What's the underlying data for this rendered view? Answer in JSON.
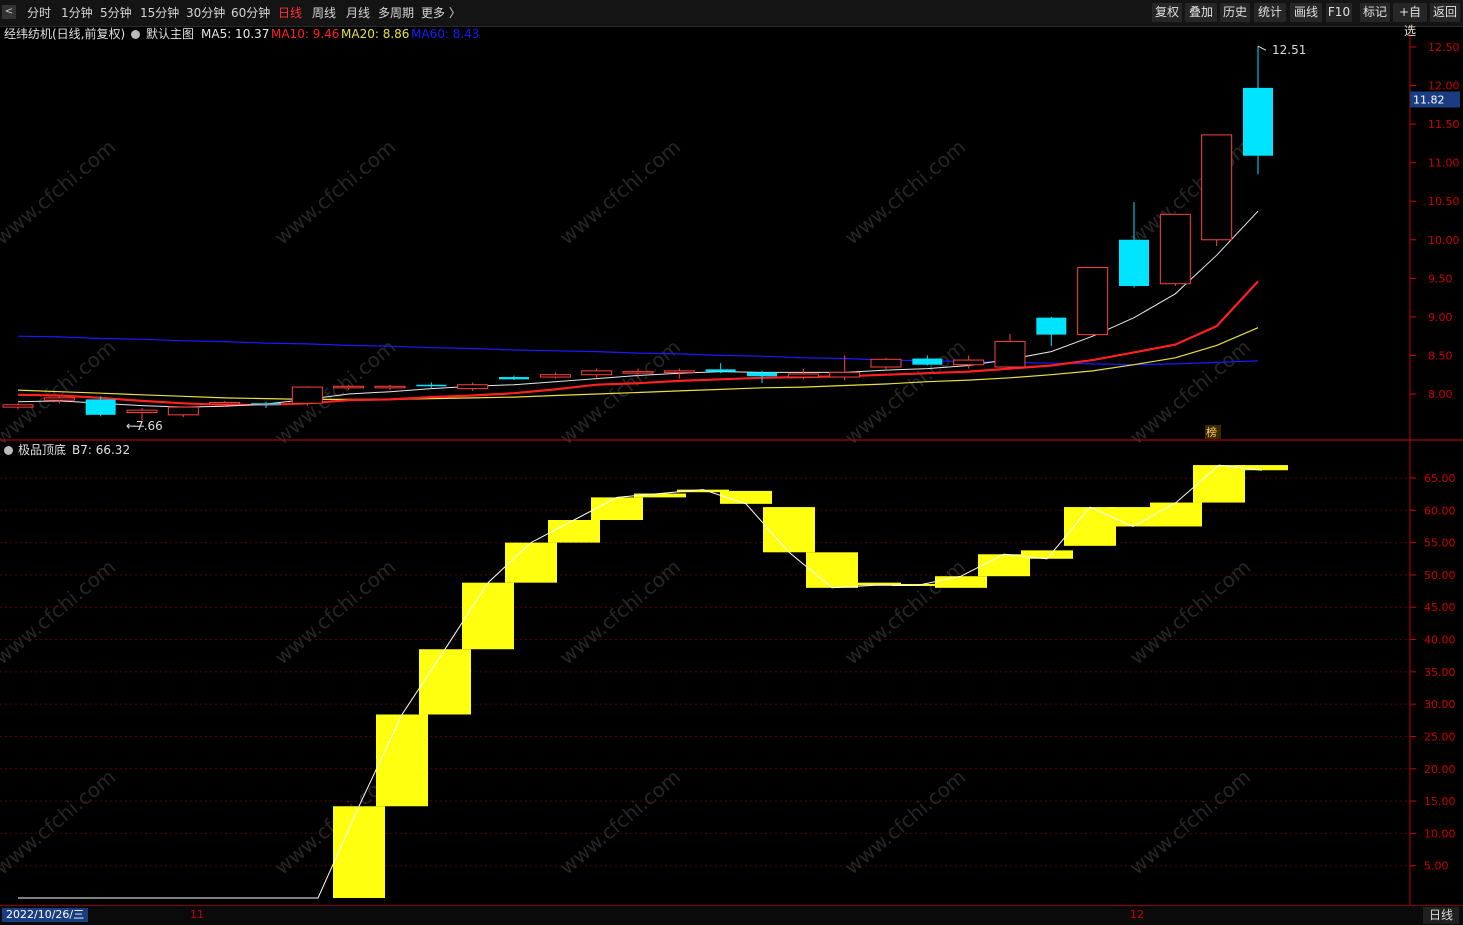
{
  "toolbar": {
    "periods": [
      "分时",
      "1分钟",
      "5分钟",
      "15分钟",
      "30分钟",
      "60分钟",
      "日线",
      "周线",
      "月线",
      "多周期",
      "更多 〉"
    ],
    "active_period": "日线",
    "right_buttons": [
      "复权",
      "叠加",
      "历史",
      "统计",
      "画线",
      "F10",
      "标记",
      "+自选",
      "返回"
    ]
  },
  "info": {
    "stock": "经纬纺机(日线,前复权)",
    "template": "默认主图",
    "ma5_label": "MA5: 10.37",
    "ma10_label": "MA10: 9.46",
    "ma20_label": "MA20: 8.86",
    "ma60_label": "MA60: 8.43"
  },
  "indicator": {
    "name": "极品顶底",
    "value_label": "B7: 66.32"
  },
  "colors": {
    "ma5": "#e8e8e8",
    "ma10": "#ff2020",
    "ma20": "#e8e040",
    "ma60": "#1a1aff",
    "up": "#ff4040",
    "down": "#00e5ff",
    "bar": "#ffff10",
    "axis": "#cc0000"
  },
  "price_axis": {
    "ticks": [
      "12.50",
      "12.00",
      "11.50",
      "11.00",
      "10.50",
      "10.00",
      "9.50",
      "9.00",
      "8.50",
      "8.00"
    ],
    "current": "11.82"
  },
  "ind_axis": {
    "ticks": [
      "65.00",
      "60.00",
      "55.00",
      "50.00",
      "45.00",
      "40.00",
      "35.00",
      "30.00",
      "25.00",
      "20.00",
      "15.00",
      "10.00",
      "5.00"
    ]
  },
  "annotations": {
    "high": "12.51",
    "low": "7.66",
    "bang": "榜"
  },
  "bottom": {
    "date": "2022/10/26/三",
    "months": [
      "11",
      "12"
    ],
    "period_button": "日线"
  },
  "watermark": "www.cfchi.com",
  "chart_data": {
    "type": "candlestick",
    "ylim_price": [
      7.6,
      12.6
    ],
    "ylim_indicator": [
      0,
      70
    ],
    "candles": [
      {
        "o": 7.83,
        "h": 7.88,
        "l": 7.8,
        "c": 7.86
      },
      {
        "o": 7.92,
        "h": 7.98,
        "l": 7.88,
        "c": 7.95
      },
      {
        "o": 7.93,
        "h": 7.97,
        "l": 7.71,
        "c": 7.73
      },
      {
        "o": 7.76,
        "h": 7.82,
        "l": 7.66,
        "c": 7.79
      },
      {
        "o": 7.73,
        "h": 7.84,
        "l": 7.7,
        "c": 7.83
      },
      {
        "o": 7.87,
        "h": 7.91,
        "l": 7.84,
        "c": 7.89
      },
      {
        "o": 7.88,
        "h": 7.9,
        "l": 7.82,
        "c": 7.87
      },
      {
        "o": 7.88,
        "h": 8.1,
        "l": 7.85,
        "c": 8.09
      },
      {
        "o": 8.08,
        "h": 8.12,
        "l": 8.05,
        "c": 8.1
      },
      {
        "o": 8.08,
        "h": 8.12,
        "l": 8.05,
        "c": 8.1
      },
      {
        "o": 8.12,
        "h": 8.15,
        "l": 8.08,
        "c": 8.1
      },
      {
        "o": 8.07,
        "h": 8.15,
        "l": 8.04,
        "c": 8.12
      },
      {
        "o": 8.22,
        "h": 8.24,
        "l": 8.18,
        "c": 8.19
      },
      {
        "o": 8.22,
        "h": 8.28,
        "l": 8.2,
        "c": 8.25
      },
      {
        "o": 8.25,
        "h": 8.33,
        "l": 8.21,
        "c": 8.3
      },
      {
        "o": 8.28,
        "h": 8.33,
        "l": 8.21,
        "c": 8.29
      },
      {
        "o": 8.28,
        "h": 8.33,
        "l": 8.2,
        "c": 8.3
      },
      {
        "o": 8.32,
        "h": 8.4,
        "l": 8.27,
        "c": 8.29
      },
      {
        "o": 8.28,
        "h": 8.3,
        "l": 8.14,
        "c": 8.23
      },
      {
        "o": 8.22,
        "h": 8.33,
        "l": 8.19,
        "c": 8.26
      },
      {
        "o": 8.22,
        "h": 8.5,
        "l": 8.18,
        "c": 8.28
      },
      {
        "o": 8.35,
        "h": 8.47,
        "l": 8.31,
        "c": 8.45
      },
      {
        "o": 8.46,
        "h": 8.5,
        "l": 8.37,
        "c": 8.38
      },
      {
        "o": 8.38,
        "h": 8.5,
        "l": 8.33,
        "c": 8.44
      },
      {
        "o": 8.35,
        "h": 8.78,
        "l": 8.33,
        "c": 8.68
      },
      {
        "o": 8.99,
        "h": 9.0,
        "l": 8.62,
        "c": 8.77
      },
      {
        "o": 8.77,
        "h": 9.65,
        "l": 8.75,
        "c": 9.64
      },
      {
        "o": 10.0,
        "h": 10.49,
        "l": 9.38,
        "c": 9.4
      },
      {
        "o": 9.43,
        "h": 10.33,
        "l": 9.4,
        "c": 10.33
      },
      {
        "o": 10.0,
        "h": 11.36,
        "l": 9.92,
        "c": 11.36
      },
      {
        "o": 11.97,
        "h": 12.51,
        "l": 10.85,
        "c": 11.09
      }
    ],
    "ma5": [
      7.9,
      7.91,
      7.88,
      7.85,
      7.83,
      7.84,
      7.87,
      7.93,
      8.0,
      8.03,
      8.07,
      8.1,
      8.12,
      8.16,
      8.2,
      8.24,
      8.27,
      8.29,
      8.28,
      8.28,
      8.28,
      8.31,
      8.33,
      8.37,
      8.45,
      8.55,
      8.75,
      8.99,
      9.3,
      9.8,
      10.37
    ],
    "ma10": [
      7.99,
      7.98,
      7.95,
      7.91,
      7.88,
      7.86,
      7.86,
      7.88,
      7.92,
      7.93,
      7.96,
      7.98,
      8.01,
      8.06,
      8.12,
      8.14,
      8.17,
      8.19,
      8.21,
      8.22,
      8.23,
      8.25,
      8.27,
      8.29,
      8.33,
      8.37,
      8.44,
      8.54,
      8.64,
      8.88,
      9.46
    ],
    "ma20": [
      8.05,
      8.03,
      8.01,
      7.99,
      7.97,
      7.95,
      7.94,
      7.93,
      7.93,
      7.93,
      7.94,
      7.95,
      7.96,
      7.98,
      8.0,
      8.02,
      8.04,
      8.06,
      8.08,
      8.09,
      8.11,
      8.13,
      8.16,
      8.18,
      8.21,
      8.25,
      8.3,
      8.38,
      8.47,
      8.63,
      8.86
    ],
    "ma60": [
      8.75,
      8.74,
      8.72,
      8.71,
      8.69,
      8.68,
      8.66,
      8.65,
      8.63,
      8.62,
      8.6,
      8.59,
      8.57,
      8.56,
      8.55,
      8.53,
      8.52,
      8.5,
      8.49,
      8.47,
      8.46,
      8.44,
      8.43,
      8.42,
      8.41,
      8.4,
      8.39,
      8.38,
      8.39,
      8.41,
      8.43
    ],
    "b7_bars": [
      {
        "o": 0.0,
        "c": 14.2
      },
      {
        "o": 14.2,
        "c": 28.4
      },
      {
        "o": 28.4,
        "c": 38.5
      },
      {
        "o": 38.5,
        "c": 48.8
      },
      {
        "o": 48.8,
        "c": 55.0
      },
      {
        "o": 55.0,
        "c": 58.5
      },
      {
        "o": 58.5,
        "c": 62.0
      },
      {
        "o": 62.0,
        "c": 62.6
      },
      {
        "o": 62.8,
        "c": 63.2
      },
      {
        "o": 63.0,
        "c": 61.0
      },
      {
        "o": 60.5,
        "c": 53.5
      },
      {
        "o": 53.5,
        "c": 48.0
      },
      {
        "o": 48.8,
        "c": 48.4
      },
      {
        "o": 48.6,
        "c": 48.4
      },
      {
        "o": 48.0,
        "c": 49.8
      },
      {
        "o": 49.8,
        "c": 53.2
      },
      {
        "o": 53.8,
        "c": 52.5
      },
      {
        "o": 54.5,
        "c": 60.5
      },
      {
        "o": 60.5,
        "c": 57.5
      },
      {
        "o": 57.5,
        "c": 61.2
      },
      {
        "o": 61.2,
        "c": 67.0
      },
      {
        "o": 67.0,
        "c": 66.2
      }
    ],
    "b7_line_pre": 0.0
  }
}
